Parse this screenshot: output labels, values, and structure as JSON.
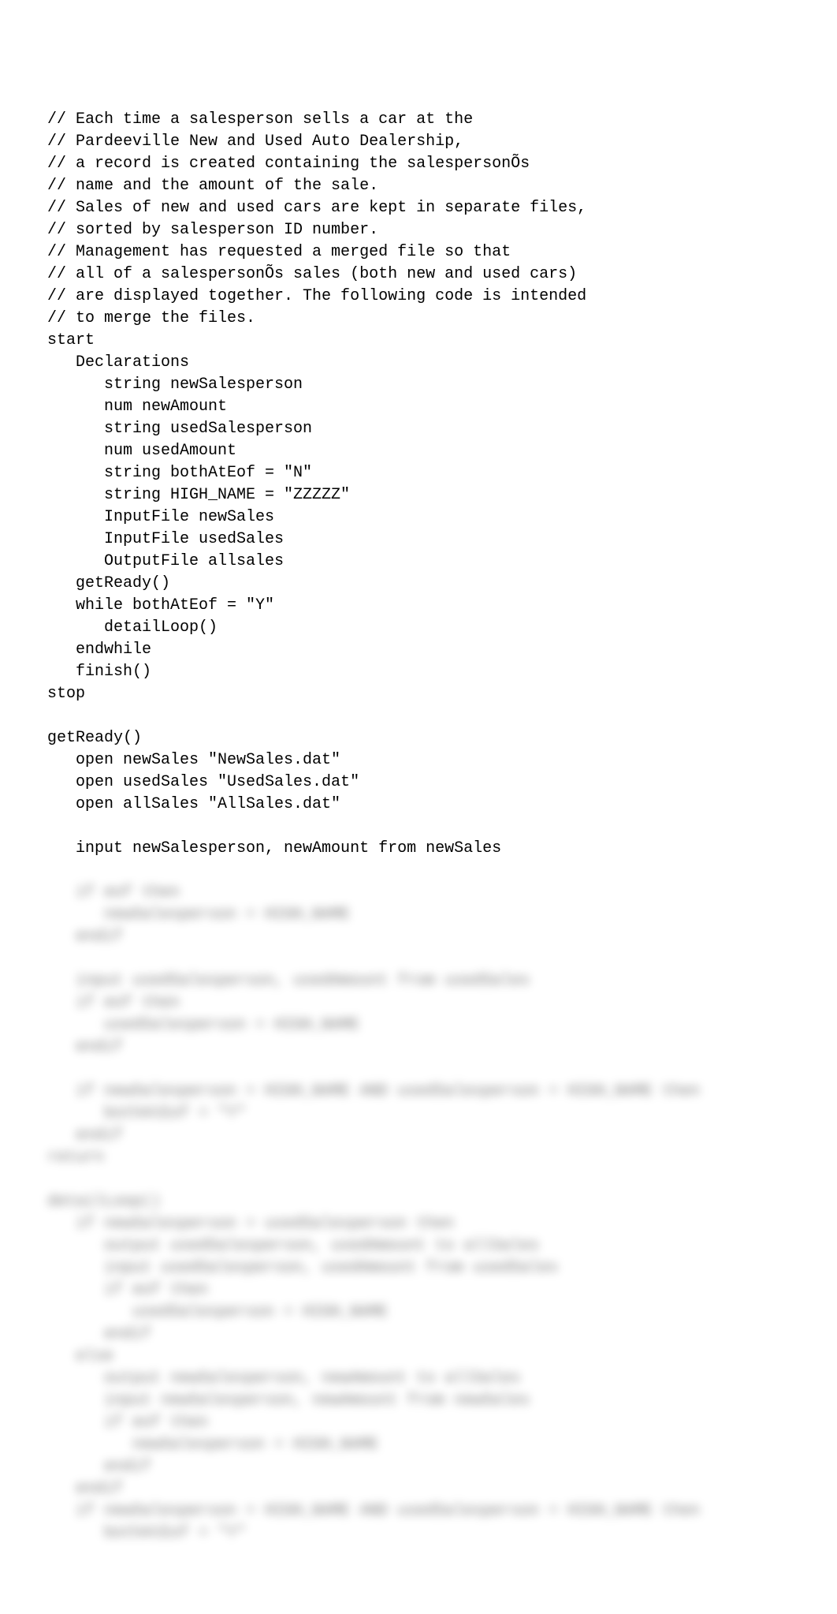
{
  "code": {
    "clear_lines": [
      "// Each time a salesperson sells a car at the",
      "// Pardeeville New and Used Auto Dealership,",
      "// a record is created containing the salespersonÕs",
      "// name and the amount of the sale.",
      "// Sales of new and used cars are kept in separate files,",
      "// sorted by salesperson ID number.",
      "// Management has requested a merged file so that",
      "// all of a salespersonÕs sales (both new and used cars)",
      "// are displayed together. The following code is intended",
      "// to merge the files.",
      "start",
      "   Declarations",
      "      string newSalesperson",
      "      num newAmount",
      "      string usedSalesperson",
      "      num usedAmount",
      "      string bothAtEof = \"N\"",
      "      string HIGH_NAME = \"ZZZZZ\"",
      "      InputFile newSales",
      "      InputFile usedSales",
      "      OutputFile allsales",
      "   getReady()",
      "   while bothAtEof = \"Y\"",
      "      detailLoop()",
      "   endwhile",
      "   finish()",
      "stop",
      "",
      "getReady()",
      "   open newSales \"NewSales.dat\"",
      "   open usedSales \"UsedSales.dat\"",
      "   open allSales \"AllSales.dat\"",
      "",
      "   input newSalesperson, newAmount from newSales"
    ],
    "blurred_lines": [
      "   if eof then",
      "      newSalesperson = HIGH_NAME",
      "   endif",
      "",
      "   input usedSalesperson, usedAmount from usedSales",
      "   if eof then",
      "      usedSalesperson = HIGH_NAME",
      "   endif",
      "",
      "   if newSalesperson = HIGH_NAME AND usedSalesperson = HIGH_NAME then",
      "      bothAtEof = \"Y\"",
      "   endif",
      "return",
      "",
      "detailLoop()",
      "   if newSalesperson > usedSalesperson then",
      "      output usedSalesperson, usedAmount to allSales",
      "      input usedSalesperson, usedAmount from usedSales",
      "      if eof then",
      "         usedSalesperson = HIGH_NAME",
      "      endif",
      "   else",
      "      output newSalesperson, newAmount to allSales",
      "      input newSalesperson, newAmount from newSales",
      "      if eof then",
      "         newSalesperson = HIGH_NAME",
      "      endif",
      "   endif",
      "   if newSalesperson = HIGH_NAME AND usedSalesperson = HIGH_NAME then",
      "      bothAtEof = \"Y\""
    ]
  }
}
